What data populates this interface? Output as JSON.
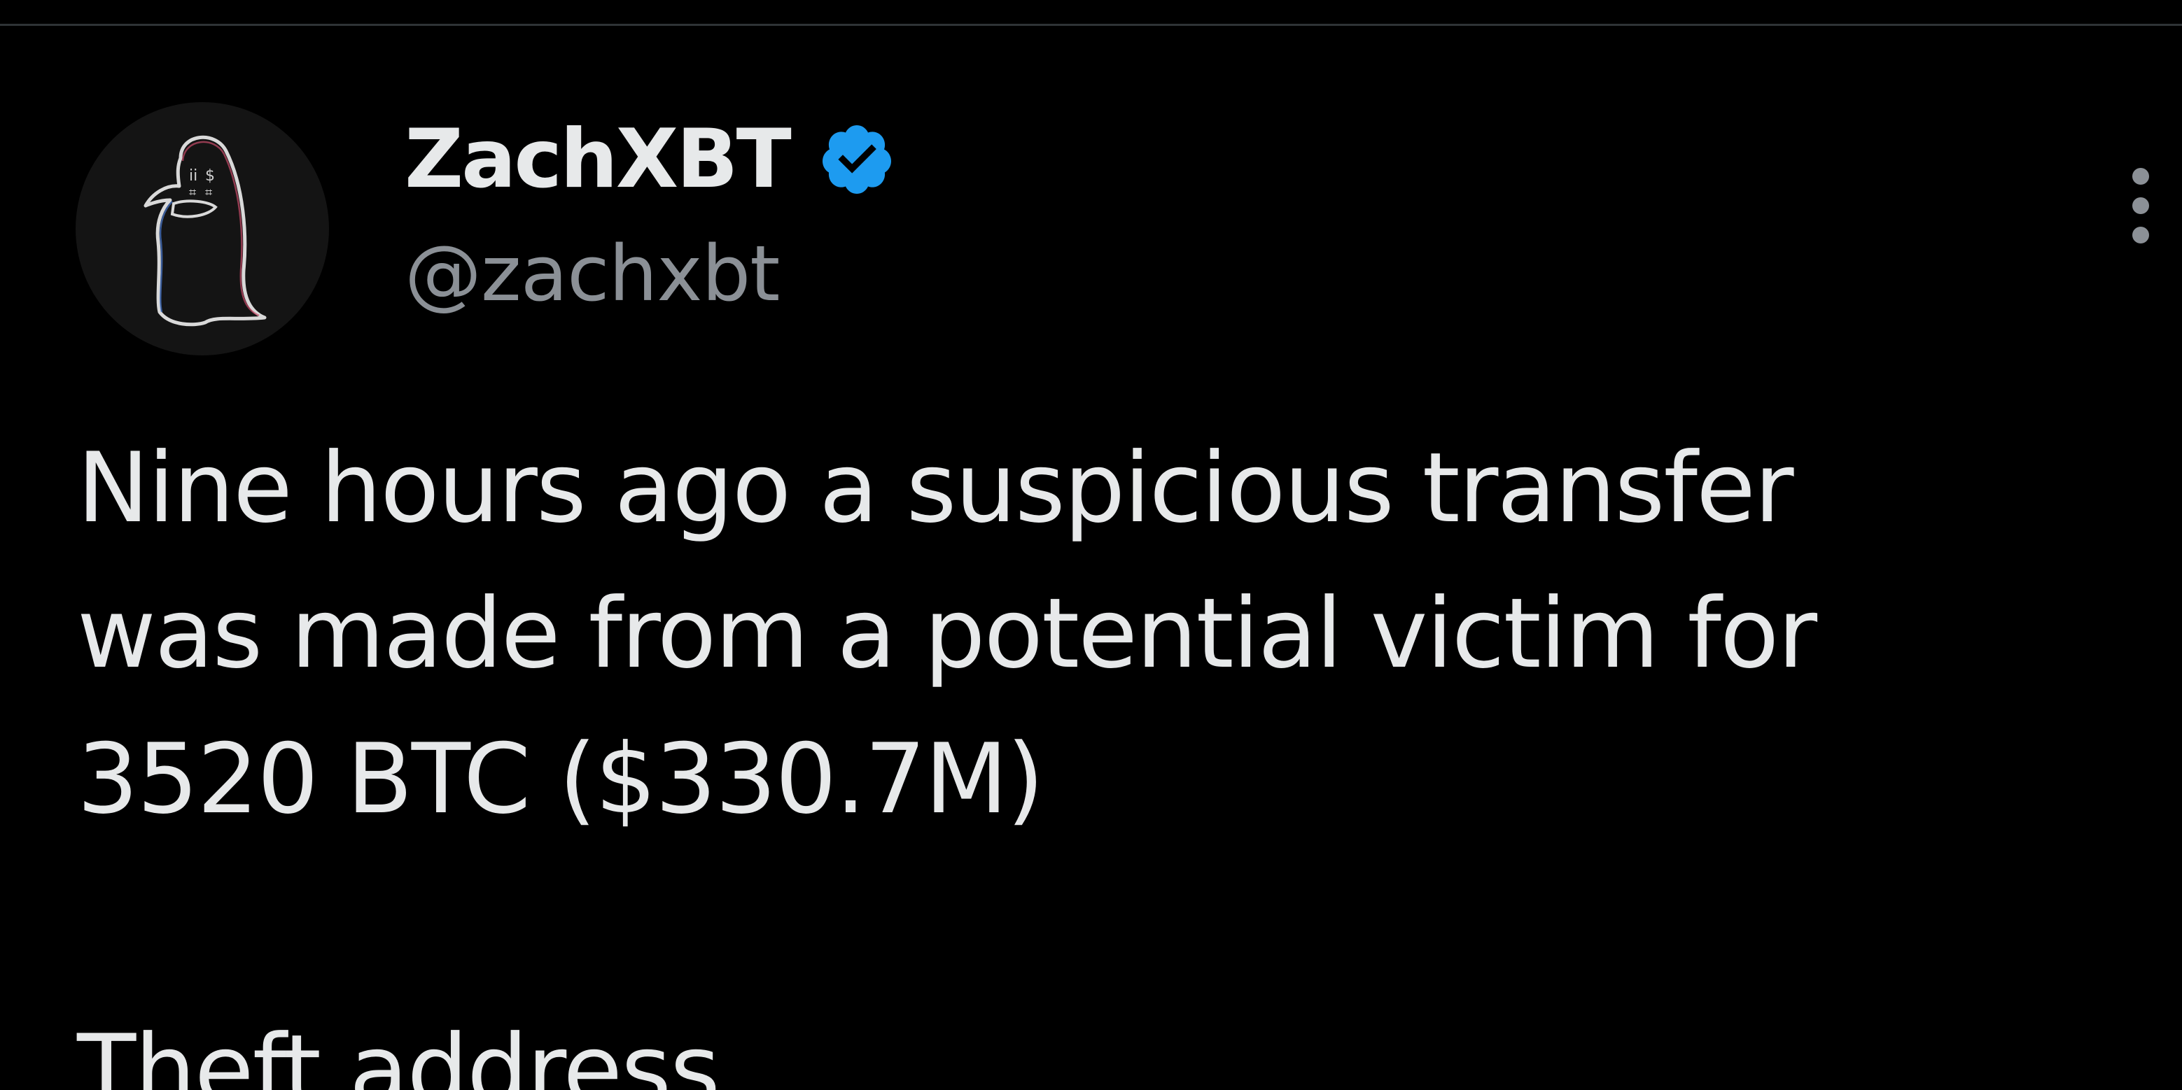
{
  "author": {
    "display_name": "ZachXBT",
    "handle": "@zachxbt",
    "verified": true,
    "avatar_icon": "ghost-penguin-sketch-avatar",
    "verified_icon": "verified-badge-icon",
    "verified_color": "#1d9bf0"
  },
  "tweet": {
    "lines": [
      "Nine hours ago a suspicious transfer",
      "was made from a potential victim for",
      "3520 BTC ($330.7M)",
      "",
      "Theft address"
    ]
  },
  "actions": {
    "more_icon": "more-vertical-icon"
  },
  "colors": {
    "background": "#000000",
    "primary_text": "#e7e9ea",
    "secondary_text": "#8b9096",
    "divider": "#2f3336"
  }
}
